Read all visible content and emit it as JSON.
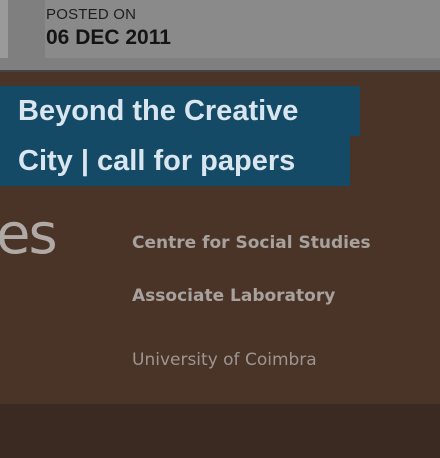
{
  "post_meta": {
    "posted_label": "POSTED ON",
    "posted_date": "06 DEC 2011"
  },
  "post": {
    "title_line1": "Beyond the Creative",
    "title_line2": "City | call for papers"
  },
  "hero_image": {
    "logo_fragment": "es",
    "org_line1": "Centre for Social Studies",
    "org_line2": "Associate Laboratory",
    "org_line3": "University of  Coimbra"
  },
  "colors": {
    "title_bg": "#144a66",
    "hero_bg": "#4a3327",
    "header_bg": "#8a8a8a"
  }
}
